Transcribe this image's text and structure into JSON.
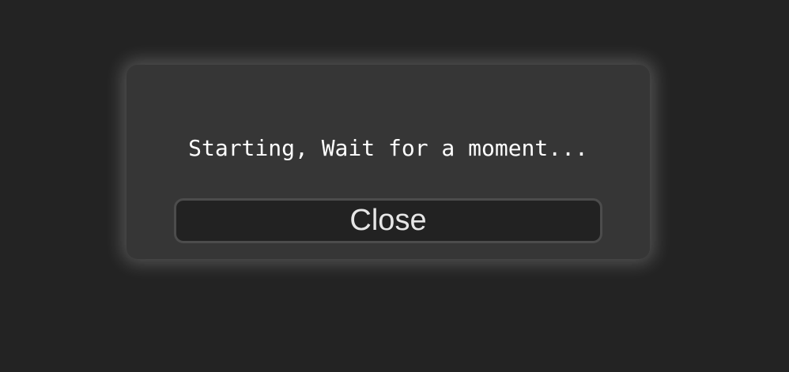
{
  "dialog": {
    "message": "Starting, Wait for a moment...",
    "close_label": "Close"
  },
  "colors": {
    "background": "#232323",
    "dialog_background": "#363636",
    "button_background": "#222222",
    "button_border": "#4c4c4c",
    "text": "#ffffff"
  }
}
